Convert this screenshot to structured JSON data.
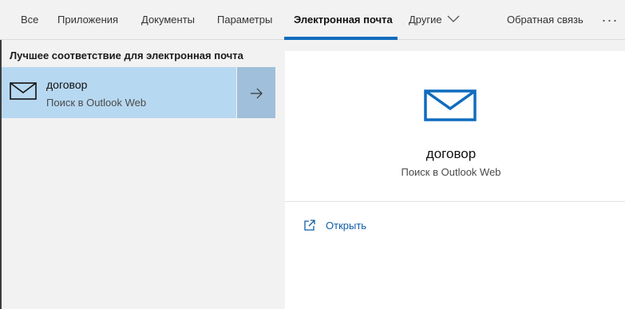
{
  "tabs": [
    {
      "label": "Все"
    },
    {
      "label": "Приложения"
    },
    {
      "label": "Документы"
    },
    {
      "label": "Параметры"
    },
    {
      "label": "Электронная почта",
      "active": true
    },
    {
      "label": "Другие"
    }
  ],
  "feedback_label": "Обратная связь",
  "more_label": "···",
  "best_match": {
    "heading": "Лучшее соответствие для электронная почта",
    "title": "договор",
    "subtitle": "Поиск в Outlook Web"
  },
  "preview": {
    "title": "договор",
    "subtitle": "Поиск в Outlook Web",
    "open_label": "Открыть"
  },
  "colors": {
    "accent": "#0f6cbd",
    "selected_bg": "#b7d8f1",
    "arrow_bg": "#9fbfda"
  },
  "icons": {
    "result": "envelope-icon",
    "arrow": "arrow-right-icon",
    "preview": "envelope-icon",
    "open": "open-external-icon",
    "more_tabs": "chevron-down-icon"
  }
}
